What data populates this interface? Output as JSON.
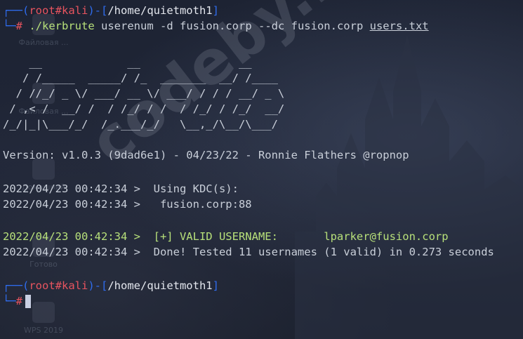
{
  "prompt1": {
    "corner_top": "┌──(",
    "user": "root",
    "hash": "#",
    "host": "kali",
    "mid": ")-[",
    "path": "/home/quietmoth1",
    "close": "]",
    "corner_bottom": "└─",
    "prompt_char": "#"
  },
  "command": {
    "exe": "./kerbrute",
    "args": " userenum -d fusion.corp --dc fusion.corp ",
    "file": "users.txt"
  },
  "banner": [
    "    __             __               __     ",
    "   / /_____  _____/ /_  _______  __/ /____ ",
    "  / //_/ _ \\/ ___/ __ \\/ ___/ / / / __/ _ \\",
    " / ,< /  __/ /  / /_/ / /  / /_/ / /_/  __/",
    "/_/|_|\\___/_/  /_.___/_/   \\__,_/\\__/\\___/ "
  ],
  "version_line": "Version: v1.0.3 (9dad6e1) - 04/23/22 - Ronnie Flathers @ropnop",
  "log": {
    "kdc_line": "2022/04/23 00:42:34 >  Using KDC(s):",
    "kdc_value": "2022/04/23 00:42:34 >   fusion.corp:88",
    "valid_line": "2022/04/23 00:42:34 >  [+] VALID USERNAME:       lparker@fusion.corp",
    "done_line": "2022/04/23 00:42:34 >  Done! Tested 11 usernames (1 valid) in 0.273 seconds"
  },
  "prompt2": {
    "corner_top": "┌──(",
    "user": "root",
    "hash": "#",
    "host": "kali",
    "mid": ")-[",
    "path": "/home/quietmoth1",
    "close": "]",
    "corner_bottom": "└─",
    "prompt_char": "#"
  },
  "desktop_icons": [
    "Файловая ...",
    "Домашний",
    "Готово",
    "WPS 2019"
  ],
  "watermark": "codeby.net",
  "colors": {
    "background": "#1c2230",
    "prompt_blue": "#2f6df0",
    "prompt_red": "#e8545f",
    "text": "#c9cfd9",
    "success_green": "#b7e07a"
  }
}
